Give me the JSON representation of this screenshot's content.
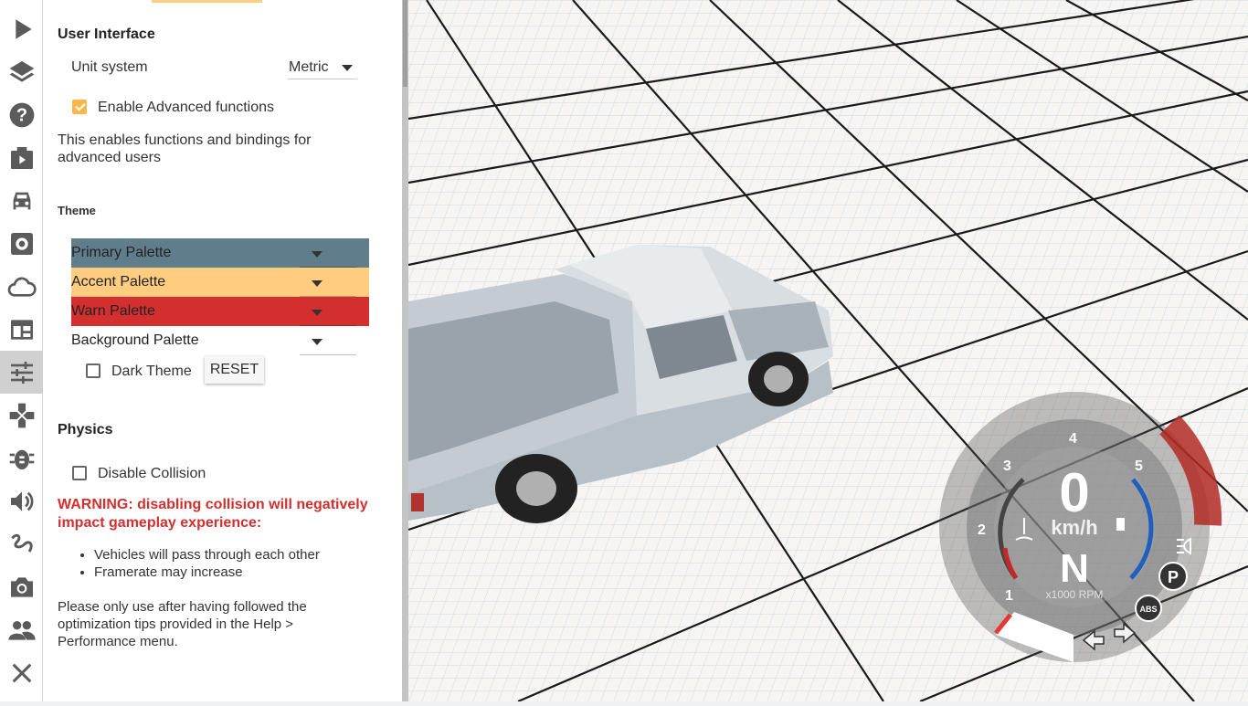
{
  "iconbar": {
    "items": [
      {
        "icon": "play-icon"
      },
      {
        "icon": "layers-icon"
      },
      {
        "icon": "help-icon"
      },
      {
        "icon": "scenario-icon"
      },
      {
        "icon": "car-icon"
      },
      {
        "icon": "settings-icon"
      },
      {
        "icon": "cloud-icon"
      },
      {
        "icon": "window-icon"
      },
      {
        "icon": "sliders-icon",
        "active": true
      },
      {
        "icon": "gamepad-icon"
      },
      {
        "icon": "bug-icon"
      },
      {
        "icon": "sound-icon"
      },
      {
        "icon": "path-icon"
      },
      {
        "icon": "camera-icon"
      },
      {
        "icon": "people-icon"
      },
      {
        "icon": "close-icon"
      }
    ]
  },
  "panel": {
    "ui_section": {
      "title": "User Interface",
      "unit_system_label": "Unit system",
      "unit_system_value": "Metric",
      "advanced_label": "Enable Advanced functions",
      "advanced_checked": true,
      "advanced_desc": "This enables functions and bindings for advanced users"
    },
    "theme": {
      "title": "Theme",
      "primary_label": "Primary Palette",
      "primary_color": "#607d8b",
      "accent_label": "Accent Palette",
      "accent_color": "#ffcc80",
      "warn_label": "Warn Palette",
      "warn_color": "#d32f2f",
      "background_label": "Background Palette",
      "dark_theme_label": "Dark Theme",
      "dark_theme_checked": false,
      "reset_label": "RESET"
    },
    "physics": {
      "title": "Physics",
      "disable_collision_label": "Disable Collision",
      "disable_collision_checked": false,
      "warning": "WARNING: disabling collision will negatively impact gameplay experience:",
      "bullets": [
        "Vehicles will pass through each other",
        "Framerate may increase"
      ],
      "note": "Please only use after having followed the optimization tips provided in the Help > Performance menu."
    }
  },
  "hud": {
    "speed": "0",
    "speed_unit": "km/h",
    "gear": "N",
    "rpm_unit": "x1000 RPM",
    "rpm_ticks": [
      "1",
      "2",
      "3",
      "4",
      "5"
    ],
    "indicators": {
      "parking": "P",
      "abs": "ABS"
    }
  }
}
